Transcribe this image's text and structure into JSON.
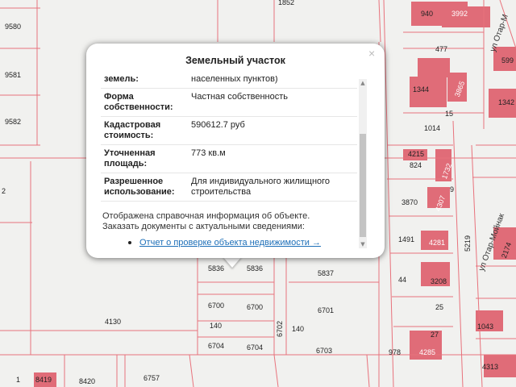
{
  "popup": {
    "title": "Земельный участок",
    "close_symbol": "×",
    "rows": [
      {
        "key": "земель:",
        "value": "населенных пунктов)"
      },
      {
        "key": "Форма собственности:",
        "value": "Частная собственность"
      },
      {
        "key": "Кадастровая стоимость:",
        "value": "590612.7 руб"
      },
      {
        "key": "Уточненная площадь:",
        "value": "773 кв.м"
      },
      {
        "key": "Разрешенное использование:",
        "value": "Для индивидуального жилищного строительства"
      }
    ],
    "note_line1": "Отображена справочная информация об объекте.",
    "note_line2": "Заказать документы с актуальными сведениями:",
    "report_link": "Отчет о проверке объекта недвижимости →",
    "scroll_up": "▲",
    "scroll_down": "▼"
  },
  "map": {
    "parcel_color": "#e06c78",
    "line_color": "#e8727c",
    "labels": {
      "p940": "940",
      "p3992": "3992",
      "p1852": "1852",
      "p477": "477",
      "p1344": "1344",
      "p3865": "3865",
      "p1342": "1342",
      "p599": "599",
      "p15": "15",
      "p1014": "1014",
      "p4215": "4215",
      "p824": "824",
      "p1732": "1732",
      "p9": "9",
      "p3870": "3870",
      "p4307": "4307",
      "p1491": "1491",
      "p4281": "4281",
      "p5219": "5219",
      "p2174": "2174",
      "p44": "44",
      "p3208": "3208",
      "p25": "25",
      "p27": "27",
      "p978": "978",
      "p4285": "4285",
      "p1043": "1043",
      "p4313": "4313",
      "p9580": "9580",
      "p9581": "9581",
      "p9582": "9582",
      "p2": "2",
      "p5836a": "5836",
      "p5836b": "5836",
      "p5837": "5837",
      "p6700a": "6700",
      "p6700b": "6700",
      "p6701": "6701",
      "p6702": "6702",
      "p140a": "140",
      "p140b": "140",
      "p6704a": "6704",
      "p6704b": "6704",
      "p6703": "6703",
      "p4130": "4130",
      "p8419": "8419",
      "p8420": "8420",
      "p6757": "6757",
      "p1": "1",
      "street_main": "ул Отар-Мойнак",
      "street_top": "ул Отар-М"
    }
  }
}
